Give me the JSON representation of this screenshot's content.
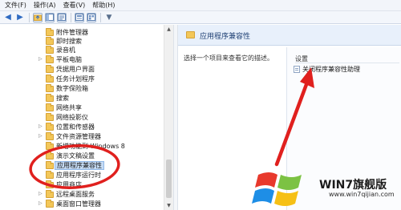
{
  "menu": [
    "文件(F)",
    "操作(A)",
    "查看(V)",
    "帮助(H)"
  ],
  "toolbar": {
    "icons": [
      "back-arrow-icon",
      "forward-arrow-icon",
      "folder-up-icon",
      "show-hide-tree-icon",
      "export-list-icon",
      "help-icon",
      "properties-icon",
      "filter-icon"
    ],
    "back_glyph": "◀",
    "forward_glyph": "▶",
    "filter_glyph": "▼"
  },
  "tree": {
    "items": [
      {
        "label": "附件管理器",
        "expandable": false
      },
      {
        "label": "即时搜索",
        "expandable": false
      },
      {
        "label": "录音机",
        "expandable": false
      },
      {
        "label": "平板电脑",
        "expandable": true
      },
      {
        "label": "凭据用户界面",
        "expandable": false
      },
      {
        "label": "任务计划程序",
        "expandable": false
      },
      {
        "label": "数字保险箱",
        "expandable": false
      },
      {
        "label": "搜索",
        "expandable": false
      },
      {
        "label": "网络共享",
        "expandable": false
      },
      {
        "label": "网络投影仪",
        "expandable": false
      },
      {
        "label": "位置和传感器",
        "expandable": true
      },
      {
        "label": "文件资源管理器",
        "expandable": true
      },
      {
        "label": "新增功能到 Windows 8",
        "expandable": false
      },
      {
        "label": "演示文稿设置",
        "expandable": false
      },
      {
        "label": "应用程序兼容性",
        "expandable": false,
        "selected": true
      },
      {
        "label": "应用程序运行时",
        "expandable": false
      },
      {
        "label": "应用商店",
        "expandable": false
      },
      {
        "label": "远程桌面服务",
        "expandable": true
      },
      {
        "label": "桌面窗口管理器",
        "expandable": true
      }
    ],
    "arrow_glyph": "▷",
    "scroll_up": "▲",
    "scroll_down": "▼"
  },
  "right": {
    "title": "应用程序兼容性",
    "description": "选择一个项目来查看它的描述。",
    "settings_header": "设置",
    "setting_item": "关闭程序兼容性助理"
  },
  "colors": {
    "annotation_red": "#e0201e",
    "selection": "#c6dcf5"
  },
  "watermark": {
    "text": "WIN7旗舰版",
    "url": "www.win7qijian.com"
  }
}
